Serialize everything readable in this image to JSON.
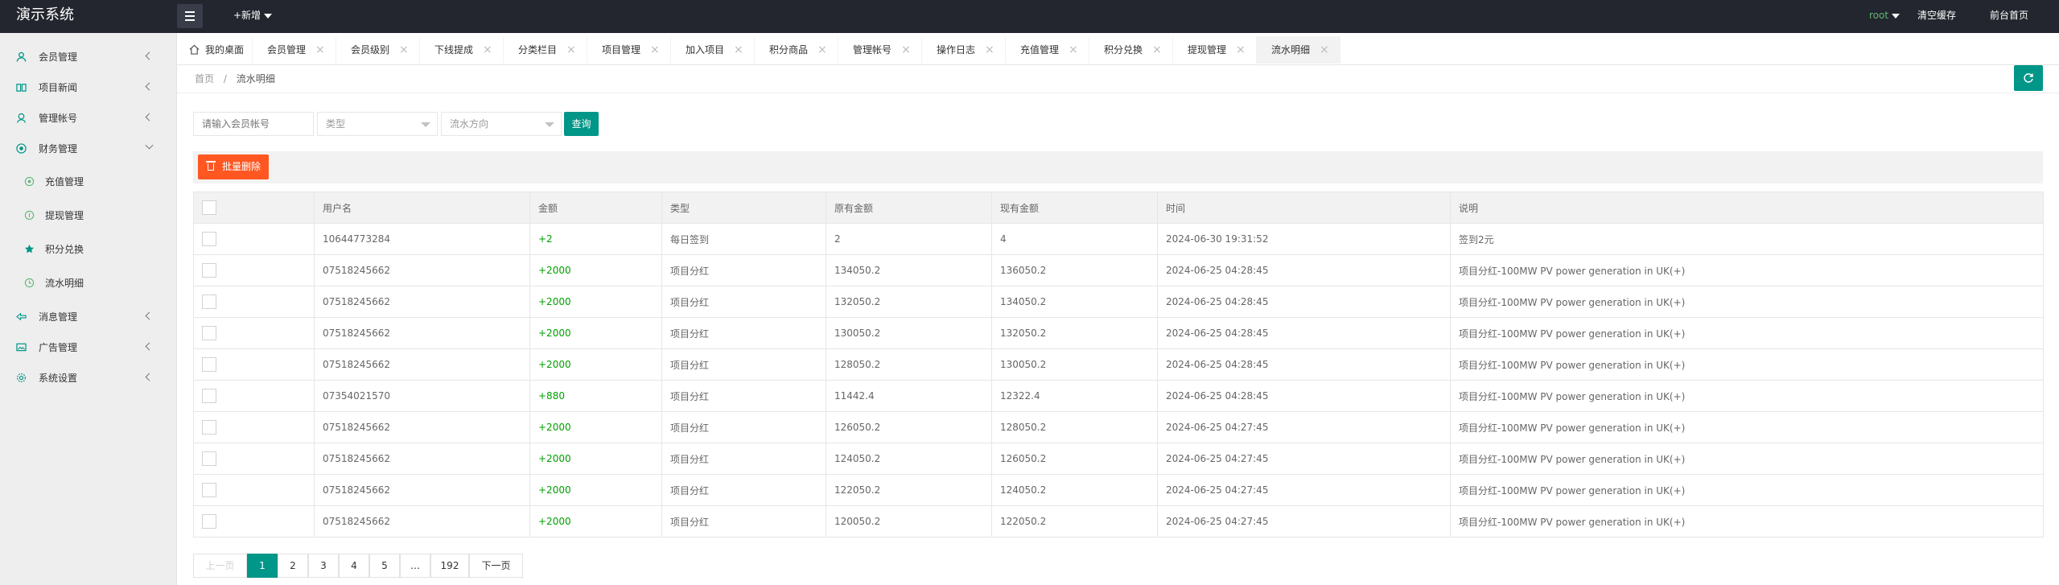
{
  "header": {
    "logo": "演示系统",
    "add_new": "+新增",
    "user": "root",
    "clear_cache": "清空缓存",
    "frontend": "前台首页"
  },
  "sidebar": {
    "items": [
      {
        "label": "会员管理",
        "icon": "user-icon"
      },
      {
        "label": "项目新闻",
        "icon": "book-icon"
      },
      {
        "label": "管理帐号",
        "icon": "admin-icon"
      },
      {
        "label": "财务管理",
        "icon": "finance-icon"
      },
      {
        "label": "充值管理",
        "icon": "recharge-icon"
      },
      {
        "label": "提现管理",
        "icon": "withdraw-icon"
      },
      {
        "label": "积分兑换",
        "icon": "star-icon"
      },
      {
        "label": "流水明细",
        "icon": "clock-icon"
      },
      {
        "label": "消息管理",
        "icon": "message-icon"
      },
      {
        "label": "广告管理",
        "icon": "image-icon"
      },
      {
        "label": "系统设置",
        "icon": "gear-icon"
      }
    ]
  },
  "tabs": [
    "我的桌面",
    "会员管理",
    "会员级别",
    "下线提成",
    "分类栏目",
    "项目管理",
    "加入项目",
    "积分商品",
    "管理帐号",
    "操作日志",
    "充值管理",
    "积分兑换",
    "提现管理",
    "流水明细"
  ],
  "breadcrumb": {
    "home": "首页",
    "sep": "/",
    "current": "流水明细"
  },
  "filters": {
    "account_placeholder": "请输入会员帐号",
    "type_value": "类型",
    "direction_value": "流水方向",
    "search_label": "查询"
  },
  "batch_delete_label": "批量删除",
  "table": {
    "headers": [
      "用户名",
      "金额",
      "类型",
      "原有金额",
      "现有金额",
      "时间",
      "说明"
    ],
    "rows": [
      [
        "10644773284",
        "+2",
        "每日签到",
        "2",
        "4",
        "2024-06-30 19:31:52",
        "签到2元"
      ],
      [
        "07518245662",
        "+2000",
        "项目分红",
        "134050.2",
        "136050.2",
        "2024-06-25 04:28:45",
        "项目分红-100MW PV power generation in UK(+)"
      ],
      [
        "07518245662",
        "+2000",
        "项目分红",
        "132050.2",
        "134050.2",
        "2024-06-25 04:28:45",
        "项目分红-100MW PV power generation in UK(+)"
      ],
      [
        "07518245662",
        "+2000",
        "项目分红",
        "130050.2",
        "132050.2",
        "2024-06-25 04:28:45",
        "项目分红-100MW PV power generation in UK(+)"
      ],
      [
        "07518245662",
        "+2000",
        "项目分红",
        "128050.2",
        "130050.2",
        "2024-06-25 04:28:45",
        "项目分红-100MW PV power generation in UK(+)"
      ],
      [
        "07354021570",
        "+880",
        "项目分红",
        "11442.4",
        "12322.4",
        "2024-06-25 04:28:45",
        "项目分红-100MW PV power generation in UK(+)"
      ],
      [
        "07518245662",
        "+2000",
        "项目分红",
        "126050.2",
        "128050.2",
        "2024-06-25 04:27:45",
        "项目分红-100MW PV power generation in UK(+)"
      ],
      [
        "07518245662",
        "+2000",
        "项目分红",
        "124050.2",
        "126050.2",
        "2024-06-25 04:27:45",
        "项目分红-100MW PV power generation in UK(+)"
      ],
      [
        "07518245662",
        "+2000",
        "项目分红",
        "122050.2",
        "124050.2",
        "2024-06-25 04:27:45",
        "项目分红-100MW PV power generation in UK(+)"
      ],
      [
        "07518245662",
        "+2000",
        "项目分红",
        "120050.2",
        "122050.2",
        "2024-06-25 04:27:45",
        "项目分红-100MW PV power generation in UK(+)"
      ]
    ]
  },
  "pagination": {
    "prev": "上一页",
    "pages": [
      "1",
      "2",
      "3",
      "4",
      "5",
      "…",
      "192"
    ],
    "next": "下一页",
    "current": "1"
  },
  "colors": {
    "accent": "#009688",
    "danger": "#ff5722",
    "topbar": "#23262e",
    "amount": "#00a000",
    "user": "#5fb878"
  }
}
